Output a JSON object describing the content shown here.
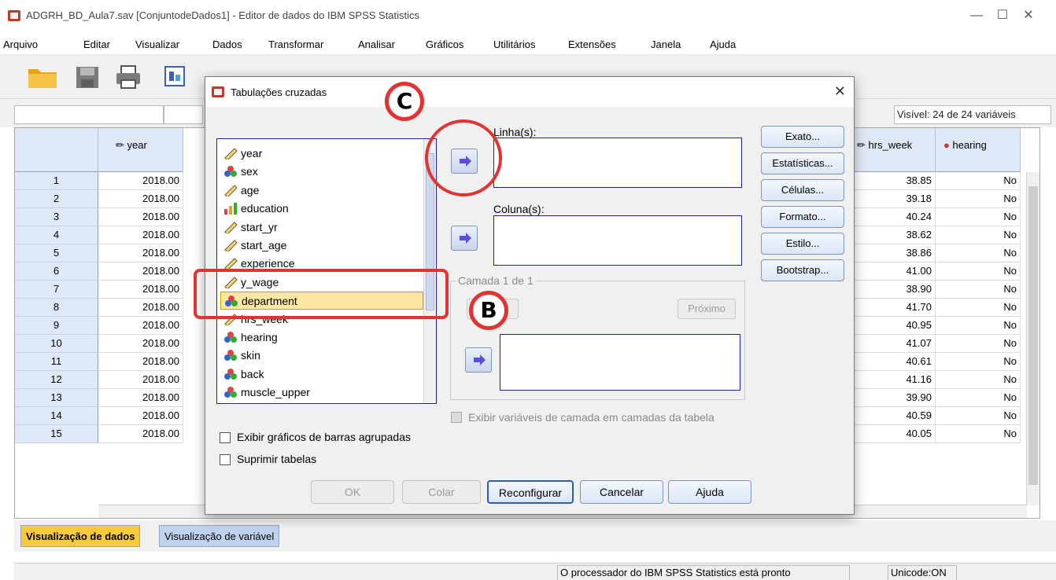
{
  "window": {
    "title": "ADGRH_BD_Aula7.sav [ConjuntodeDados1] - Editor de dados do IBM SPSS Statistics",
    "minimize_icon": "minimize-icon",
    "maximize_icon": "maximize-icon",
    "close_icon": "close-icon"
  },
  "menu": [
    "Arquivo",
    "Editar",
    "Visualizar",
    "Dados",
    "Transformar",
    "Analisar",
    "Gráficos",
    "Utilitários",
    "Extensões",
    "Janela",
    "Ajuda"
  ],
  "toolbar_icons": [
    "open-folder-icon",
    "save-icon",
    "print-icon",
    "dialog-recall-icon",
    "chart-icon",
    "variable-icon",
    "find-icon",
    "table-icon",
    "value-labels-icon",
    "spell-icon"
  ],
  "visible_vars": "Visível: 24 de 24 variáveis",
  "grid": {
    "headers": [
      "year",
      "hrs_week",
      "hearing"
    ],
    "rows": [
      {
        "n": "1",
        "year": "2018.00",
        "hrs": "38.85",
        "hear": "No"
      },
      {
        "n": "2",
        "year": "2018.00",
        "hrs": "39.18",
        "hear": "No"
      },
      {
        "n": "3",
        "year": "2018.00",
        "hrs": "40.24",
        "hear": "No"
      },
      {
        "n": "4",
        "year": "2018.00",
        "hrs": "38.62",
        "hear": "No"
      },
      {
        "n": "5",
        "year": "2018.00",
        "hrs": "38.86",
        "hear": "No"
      },
      {
        "n": "6",
        "year": "2018.00",
        "hrs": "41.00",
        "hear": "No"
      },
      {
        "n": "7",
        "year": "2018.00",
        "hrs": "38.90",
        "hear": "No"
      },
      {
        "n": "8",
        "year": "2018.00",
        "hrs": "41.70",
        "hear": "No"
      },
      {
        "n": "9",
        "year": "2018.00",
        "hrs": "40.95",
        "hear": "No"
      },
      {
        "n": "10",
        "year": "2018.00",
        "hrs": "41.07",
        "hear": "No"
      },
      {
        "n": "11",
        "year": "2018.00",
        "hrs": "40.61",
        "hear": "No"
      },
      {
        "n": "12",
        "year": "2018.00",
        "hrs": "41.16",
        "hear": "No"
      },
      {
        "n": "13",
        "year": "2018.00",
        "hrs": "39.90",
        "hear": "No"
      },
      {
        "n": "14",
        "year": "2018.00",
        "hrs": "40.59",
        "hear": "No"
      },
      {
        "n": "15",
        "year": "2018.00",
        "hrs": "40.05",
        "hear": "No"
      }
    ]
  },
  "tabs": {
    "data_view": "Visualização de dados",
    "variable_view": "Visualização de variável"
  },
  "status": {
    "processor": "O processador do IBM SPSS Statistics  está pronto",
    "unicode": "Unicode:ON"
  },
  "dialog": {
    "title": "Tabulações cruzadas",
    "variables": [
      {
        "name": "year",
        "icon": "scale-ruler-icon"
      },
      {
        "name": "sex",
        "icon": "nominal-icon"
      },
      {
        "name": "age",
        "icon": "scale-ruler-icon"
      },
      {
        "name": "education",
        "icon": "ordinal-bars-icon"
      },
      {
        "name": "start_yr",
        "icon": "scale-ruler-icon"
      },
      {
        "name": "start_age",
        "icon": "scale-ruler-icon"
      },
      {
        "name": "experience",
        "icon": "scale-ruler-icon"
      },
      {
        "name": "y_wage",
        "icon": "scale-ruler-icon"
      },
      {
        "name": "department",
        "icon": "nominal-icon",
        "selected": true
      },
      {
        "name": "hrs_week",
        "icon": "scale-ruler-icon"
      },
      {
        "name": "hearing",
        "icon": "nominal-icon"
      },
      {
        "name": "skin",
        "icon": "nominal-icon"
      },
      {
        "name": "back",
        "icon": "nominal-icon"
      },
      {
        "name": "muscle_upper",
        "icon": "nominal-icon"
      }
    ],
    "rows_label": "Linha(s):",
    "cols_label": "Coluna(s):",
    "layer_label": "Camada 1 de 1",
    "prev_label": "",
    "next_label": "Próximo",
    "show_layer": "Exibir variáveis de camada em camadas da tabela",
    "clustered": "Exibir gráficos de barras agrupadas",
    "suppress": "Suprimir tabelas",
    "right_buttons": [
      "Exato...",
      "Estatísticas...",
      "Células...",
      "Formato...",
      "Estilo...",
      "Bootstrap..."
    ],
    "bottom_buttons": {
      "ok": "OK",
      "paste": "Colar",
      "reset": "Reconfigurar",
      "cancel": "Cancelar",
      "help": "Ajuda"
    }
  },
  "annotations": {
    "b": "B",
    "c": "C"
  },
  "colors": {
    "annotation": "#e23232",
    "selection": "#fce8a0",
    "tab_active": "#f7c93c"
  }
}
